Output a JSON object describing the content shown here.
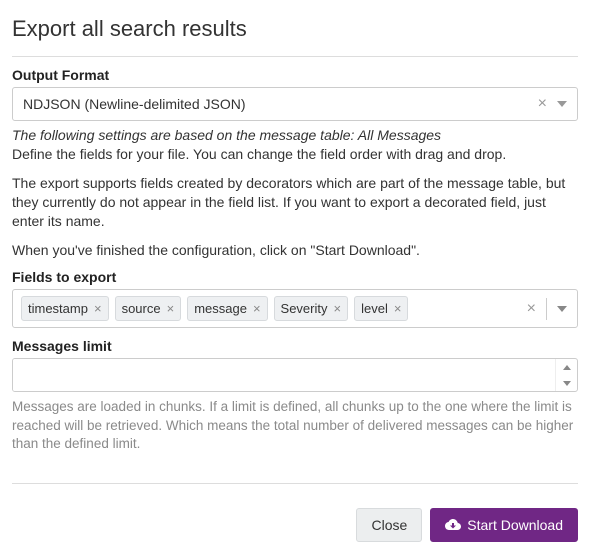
{
  "dialog": {
    "title": "Export all search results"
  },
  "outputFormat": {
    "label": "Output Format",
    "value": "NDJSON (Newline-delimited JSON)"
  },
  "info": {
    "basedOn": "The following settings are based on the message table: All Messages",
    "defineFields": "Define the fields for your file. You can change the field order with drag and drop.",
    "decoratorNote": "The export supports fields created by decorators which are part of the message table, but they currently do not appear in the field list. If you want to export a decorated field, just enter its name.",
    "finishNote": "When you've finished the configuration, click on \"Start Download\"."
  },
  "fields": {
    "label": "Fields to export",
    "items": [
      "timestamp",
      "source",
      "message",
      "Severity",
      "level"
    ]
  },
  "limit": {
    "label": "Messages limit",
    "value": "",
    "help": "Messages are loaded in chunks. If a limit is defined, all chunks up to the one where the limit is reached will be retrieved. Which means the total number of delivered messages can be higher than the defined limit."
  },
  "buttons": {
    "close": "Close",
    "start": "Start Download"
  }
}
